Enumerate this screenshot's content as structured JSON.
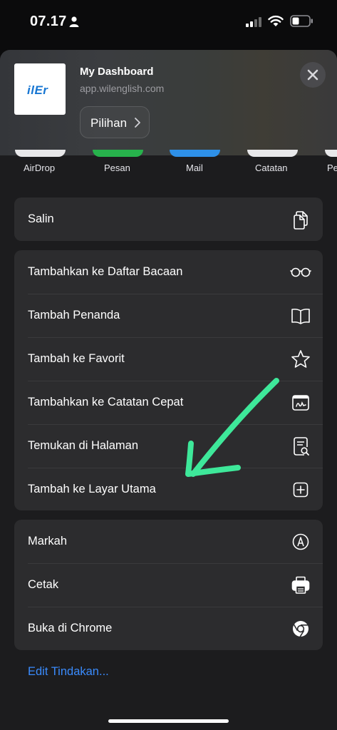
{
  "status_bar": {
    "time": "07.17"
  },
  "header": {
    "thumb_text": "ilEr",
    "title": "My Dashboard",
    "url": "app.wilenglish.com",
    "options_label": "Pilihan"
  },
  "share_apps": [
    "AirDrop",
    "Pesan",
    "Mail",
    "Catatan",
    "Pe"
  ],
  "group1": {
    "items": [
      {
        "label": "Salin",
        "icon": "copy-icon"
      }
    ]
  },
  "group2": {
    "items": [
      {
        "label": "Tambahkan ke Daftar Bacaan",
        "icon": "glasses-icon"
      },
      {
        "label": "Tambah Penanda",
        "icon": "book-icon"
      },
      {
        "label": "Tambah ke Favorit",
        "icon": "star-icon"
      },
      {
        "label": "Tambahkan ke Catatan Cepat",
        "icon": "quick-note-icon"
      },
      {
        "label": "Temukan di Halaman",
        "icon": "find-in-page-icon"
      },
      {
        "label": "Tambah ke Layar Utama",
        "icon": "add-square-icon"
      }
    ]
  },
  "group3": {
    "items": [
      {
        "label": "Markah",
        "icon": "markup-icon"
      },
      {
        "label": "Cetak",
        "icon": "printer-icon"
      },
      {
        "label": "Buka di Chrome",
        "icon": "chrome-icon"
      }
    ]
  },
  "edit_actions": "Edit Tindakan...",
  "colors": {
    "accent_link": "#3a8bfd",
    "annotation_arrow": "#3ee89a",
    "sheet_bg": "#1c1c1e",
    "group_bg": "#2c2c2e"
  }
}
